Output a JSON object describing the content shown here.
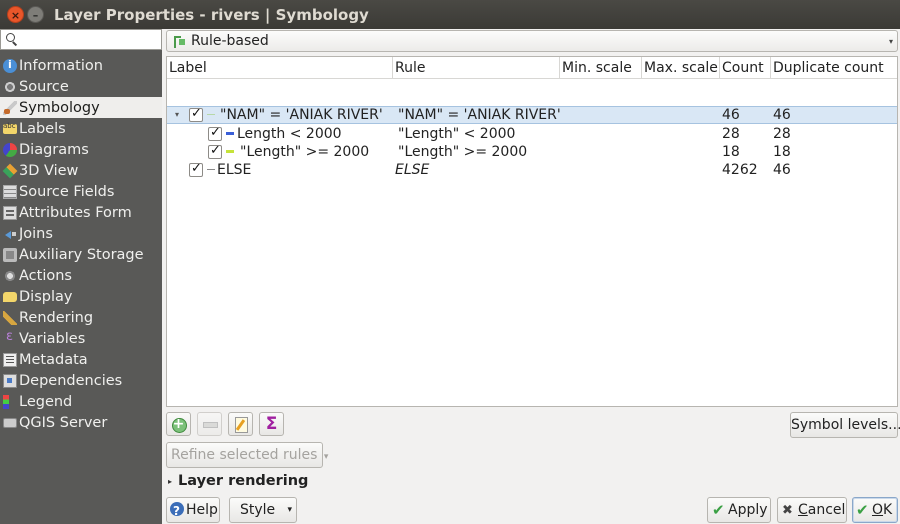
{
  "window": {
    "title": "Layer Properties - rivers | Symbology",
    "close_glyph": "×",
    "min_glyph": "–"
  },
  "sidebar": {
    "search_placeholder": "",
    "items": [
      {
        "label": "Information",
        "icon": "info-icon"
      },
      {
        "label": "Source",
        "icon": "source-icon"
      },
      {
        "label": "Symbology",
        "icon": "symbology-icon",
        "active": true
      },
      {
        "label": "Labels",
        "icon": "labels-icon"
      },
      {
        "label": "Diagrams",
        "icon": "diagrams-icon"
      },
      {
        "label": "3D View",
        "icon": "3d-view-icon"
      },
      {
        "label": "Source Fields",
        "icon": "source-fields-icon"
      },
      {
        "label": "Attributes Form",
        "icon": "attributes-form-icon"
      },
      {
        "label": "Joins",
        "icon": "joins-icon"
      },
      {
        "label": "Auxiliary Storage",
        "icon": "auxiliary-storage-icon"
      },
      {
        "label": "Actions",
        "icon": "actions-icon"
      },
      {
        "label": "Display",
        "icon": "display-icon"
      },
      {
        "label": "Rendering",
        "icon": "rendering-icon"
      },
      {
        "label": "Variables",
        "icon": "variables-icon"
      },
      {
        "label": "Metadata",
        "icon": "metadata-icon"
      },
      {
        "label": "Dependencies",
        "icon": "dependencies-icon"
      },
      {
        "label": "Legend",
        "icon": "legend-icon"
      },
      {
        "label": "QGIS Server",
        "icon": "qgis-server-icon"
      }
    ]
  },
  "renderer": {
    "selected": "Rule-based"
  },
  "rules_table": {
    "headers": [
      "Label",
      "Rule",
      "Min. scale",
      "Max. scale",
      "Count",
      "Duplicate count"
    ],
    "rows": [
      {
        "label": "\"NAM\" = 'ANIAK RIVER'",
        "rule": "\"NAM\" = 'ANIAK RIVER'",
        "min_scale": "",
        "max_scale": "",
        "count": "46",
        "duplicate_count": "46",
        "checked": true,
        "symbol_color": "#b7d8a8",
        "level": 0,
        "selected": true,
        "expanded": true
      },
      {
        "label": "Length < 2000",
        "rule": "\"Length\" < 2000",
        "min_scale": "",
        "max_scale": "",
        "count": "28",
        "duplicate_count": "28",
        "checked": true,
        "symbol_color": "#3a5fd8",
        "level": 1
      },
      {
        "label": "\"Length\" >= 2000",
        "rule": "\"Length\" >= 2000",
        "min_scale": "",
        "max_scale": "",
        "count": "18",
        "duplicate_count": "18",
        "checked": true,
        "symbol_color": "#c6e33a",
        "level": 1
      },
      {
        "label": "ELSE",
        "rule": "ELSE",
        "min_scale": "",
        "max_scale": "",
        "count": "4262",
        "duplicate_count": "46",
        "checked": true,
        "symbol_color": "#8a8a8a",
        "level": 0,
        "rule_italic": true
      }
    ]
  },
  "toolbar": {
    "add_rule_icon": "add-rule-icon",
    "remove_rule_icon": "remove-rule-icon",
    "edit_rule_icon": "edit-rule-icon",
    "sigma_glyph": "Σ",
    "symbol_levels_label": "Symbol levels...",
    "refine_label": "Refine selected rules",
    "refine_arrow": "▾"
  },
  "layer_rendering": {
    "label": "Layer rendering"
  },
  "buttons": {
    "help": "Help",
    "style": "Style",
    "style_arrow": "▾",
    "apply": "Apply",
    "cancel_first": "C",
    "cancel_rest": "ancel",
    "ok_first": "O",
    "ok_rest": "K"
  }
}
